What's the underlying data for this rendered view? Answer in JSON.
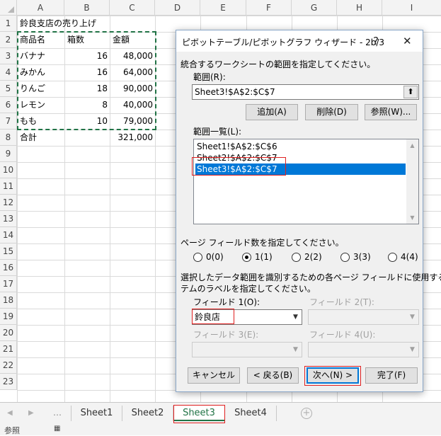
{
  "columns": [
    "A",
    "B",
    "C",
    "D",
    "E",
    "F",
    "G",
    "H",
    "I"
  ],
  "rows": [
    "1",
    "2",
    "3",
    "4",
    "5",
    "6",
    "7",
    "8",
    "9",
    "10",
    "11",
    "12",
    "13",
    "14",
    "15",
    "16",
    "17",
    "18",
    "19",
    "20",
    "21",
    "22",
    "23"
  ],
  "cells": {
    "title": "鈴良支店の売り上げ",
    "headers": [
      "商品名",
      "箱数",
      "金額"
    ],
    "data": [
      [
        "バナナ",
        "16",
        "48,000"
      ],
      [
        "みかん",
        "16",
        "64,000"
      ],
      [
        "りんご",
        "18",
        "90,000"
      ],
      [
        "レモン",
        "8",
        "40,000"
      ],
      [
        "もも",
        "10",
        "79,000"
      ]
    ],
    "total_label": "合計",
    "total_value": "321,000"
  },
  "sheet_tabs": [
    "Sheet1",
    "Sheet2",
    "Sheet3",
    "Sheet4"
  ],
  "active_tab": "Sheet3",
  "status": {
    "mode": "参照"
  },
  "dialog": {
    "title": "ピボットテーブル/ピボットグラフ ウィザード - 2b/3",
    "help": "?",
    "close": "✕",
    "instruction": "統合するワークシートの範囲を指定してください。",
    "range_label": "範囲(R):",
    "range_value": "Sheet3!$A$2:$C$7",
    "add_button": "追加(A)",
    "delete_button": "削除(D)",
    "browse_button": "参照(W)...",
    "list_label": "範囲一覧(L):",
    "ranges": [
      "Sheet1!$A$2:$C$6",
      "Sheet2!$A$2:$C$7",
      "Sheet3!$A$2:$C$7"
    ],
    "selected_range": "Sheet3!$A$2:$C$7",
    "page_field_label": "ページ フィールド数を指定してください。",
    "page_options": [
      "0(0)",
      "1(1)",
      "2(2)",
      "3(3)",
      "4(4)"
    ],
    "page_selected": "1(1)",
    "label_instruction_1": "選択したデータ範囲を識別するための各ページ フィールドに使用するアイ",
    "label_instruction_2": "テムのラベルを指定してください。",
    "field1_label": "フィールド 1(O):",
    "field1_value": "鈴良店",
    "field2_label": "フィールド 2(T):",
    "field3_label": "フィールド 3(E):",
    "field4_label": "フィールド 4(U):",
    "cancel_button": "キャンセル",
    "back_button": "< 戻る(B)",
    "next_button": "次へ(N) >",
    "finish_button": "完了(F)"
  }
}
